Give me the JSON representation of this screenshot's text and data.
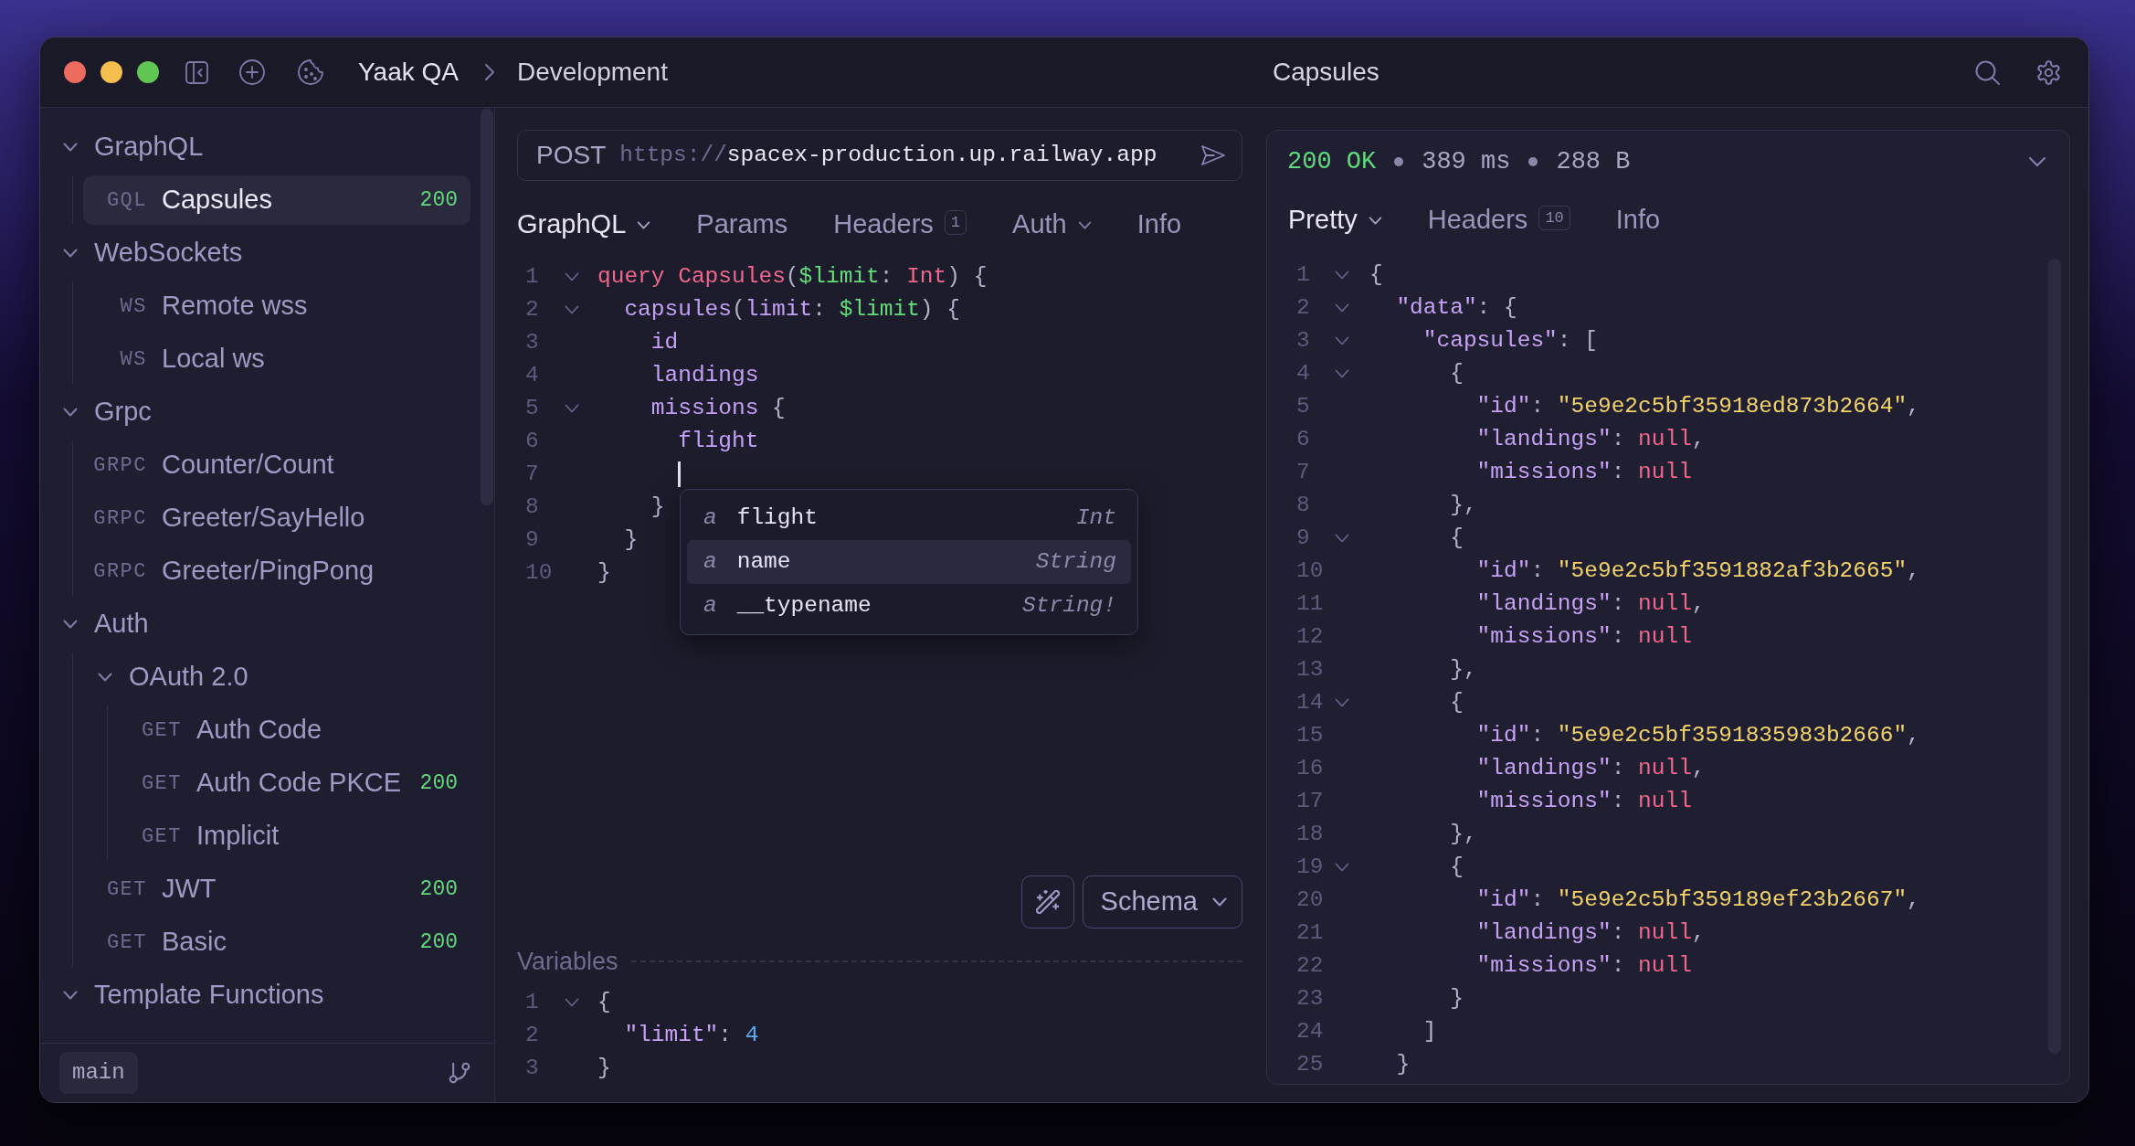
{
  "title_bar": {
    "workspace": "Yaak QA",
    "environment": "Development",
    "request_title": "Capsules"
  },
  "sidebar": {
    "items": [
      {
        "kind": "folder",
        "label": "GraphQL",
        "expanded": true,
        "selected": false,
        "children": [
          {
            "kind": "request",
            "method": "GQL",
            "label": "Capsules",
            "status": "200",
            "selected": true
          }
        ]
      },
      {
        "kind": "folder",
        "label": "WebSockets",
        "expanded": true,
        "selected": false,
        "children": [
          {
            "kind": "request",
            "method": "WS",
            "label": "Remote wss",
            "selected": false
          },
          {
            "kind": "request",
            "method": "WS",
            "label": "Local ws",
            "selected": false
          }
        ]
      },
      {
        "kind": "folder",
        "label": "Grpc",
        "expanded": true,
        "selected": false,
        "children": [
          {
            "kind": "request",
            "method": "GRPC",
            "label": "Counter/Count",
            "selected": false
          },
          {
            "kind": "request",
            "method": "GRPC",
            "label": "Greeter/SayHello",
            "selected": false
          },
          {
            "kind": "request",
            "method": "GRPC",
            "label": "Greeter/PingPong",
            "selected": false
          }
        ]
      },
      {
        "kind": "folder",
        "label": "Auth",
        "expanded": true,
        "selected": false,
        "children": [
          {
            "kind": "folder",
            "label": "OAuth 2.0",
            "expanded": true,
            "selected": false,
            "children": [
              {
                "kind": "request",
                "method": "GET",
                "label": "Auth Code",
                "selected": false
              },
              {
                "kind": "request",
                "method": "GET",
                "label": "Auth Code PKCE",
                "status": "200",
                "selected": false
              },
              {
                "kind": "request",
                "method": "GET",
                "label": "Implicit",
                "selected": false
              }
            ]
          },
          {
            "kind": "request",
            "method": "GET",
            "label": "JWT",
            "status": "200",
            "selected": false
          },
          {
            "kind": "request",
            "method": "GET",
            "label": "Basic",
            "status": "200",
            "selected": false
          }
        ]
      },
      {
        "kind": "folder",
        "label": "Template Functions",
        "expanded": true,
        "selected": false
      }
    ],
    "branch": "main"
  },
  "request": {
    "method": "POST",
    "url_scheme": "https://",
    "url_host": "spacex-production.up.railway.app",
    "tabs": [
      {
        "label": "GraphQL",
        "dropdown": true,
        "selected": true
      },
      {
        "label": "Params",
        "selected": false
      },
      {
        "label": "Headers",
        "badge": "1",
        "selected": false
      },
      {
        "label": "Auth",
        "dropdown": true,
        "selected": false
      },
      {
        "label": "Info",
        "selected": false
      }
    ],
    "query_lines": [
      {
        "number": "1",
        "tokens": [
          {
            "kind": "keyword",
            "text": "query "
          },
          {
            "kind": "name",
            "text": "Capsules"
          },
          {
            "kind": "punct",
            "text": "("
          },
          {
            "kind": "variable",
            "text": "$limit"
          },
          {
            "kind": "punct",
            "text": ": "
          },
          {
            "kind": "type",
            "text": "Int"
          },
          {
            "kind": "punct",
            "text": ") {"
          }
        ],
        "children": [
          {
            "number": "2",
            "tokens": [
              {
                "kind": "field",
                "text": "capsules"
              },
              {
                "kind": "punct",
                "text": "("
              },
              {
                "kind": "field",
                "text": "limit"
              },
              {
                "kind": "punct",
                "text": ": "
              },
              {
                "kind": "variable",
                "text": "$limit"
              },
              {
                "kind": "punct",
                "text": ") {"
              }
            ],
            "children": [
              {
                "number": "3",
                "tokens": [
                  {
                    "kind": "field",
                    "text": "id"
                  }
                ]
              },
              {
                "number": "4",
                "tokens": [
                  {
                    "kind": "field",
                    "text": "landings"
                  }
                ]
              },
              {
                "number": "5",
                "tokens": [
                  {
                    "kind": "field",
                    "text": "missions"
                  },
                  {
                    "kind": "punct",
                    "text": " {"
                  }
                ],
                "children": [
                  {
                    "number": "6",
                    "tokens": [
                      {
                        "kind": "field",
                        "text": "flight"
                      }
                    ]
                  },
                  {
                    "number": "7",
                    "cursor": true
                  }
                ]
              },
              {
                "number": "8",
                "tokens": [
                  {
                    "kind": "punct",
                    "text": "}"
                  }
                ]
              }
            ]
          },
          {
            "number": "9",
            "tokens": [
              {
                "kind": "punct",
                "text": "}"
              }
            ]
          }
        ]
      },
      {
        "number": "10",
        "tokens": [
          {
            "kind": "punct",
            "text": "}"
          }
        ]
      }
    ],
    "autocomplete": [
      {
        "kind_glyph": "a",
        "label": "flight",
        "type": "Int",
        "selected": false
      },
      {
        "kind_glyph": "a",
        "label": "name",
        "type": "String",
        "selected": true
      },
      {
        "kind_glyph": "a",
        "label": "__typename",
        "type": "String!",
        "selected": false
      }
    ],
    "schema_button": "Schema",
    "variables_label": "Variables",
    "variables_lines": [
      {
        "number": "1",
        "tokens": [
          {
            "kind": "punct",
            "text": "{"
          }
        ],
        "children": [
          {
            "number": "2",
            "tokens": [
              {
                "kind": "key",
                "text": "\"limit\""
              },
              {
                "kind": "punct",
                "text": ": "
              },
              {
                "kind": "number",
                "text": "4"
              }
            ]
          }
        ]
      },
      {
        "number": "3",
        "tokens": [
          {
            "kind": "punct",
            "text": "}"
          }
        ]
      }
    ]
  },
  "response": {
    "status": "200 OK",
    "time": "389 ms",
    "size": "288 B",
    "tabs": [
      {
        "label": "Pretty",
        "dropdown": true,
        "selected": true
      },
      {
        "label": "Headers",
        "badge": "10",
        "selected": false
      },
      {
        "label": "Info",
        "selected": false
      }
    ],
    "lines": [
      {
        "number": "1",
        "tokens": [
          {
            "kind": "punct",
            "text": "{"
          }
        ],
        "children": [
          {
            "number": "2",
            "tokens": [
              {
                "kind": "key",
                "text": "\"data\""
              },
              {
                "kind": "punct",
                "text": ": {"
              }
            ],
            "children": [
              {
                "number": "3",
                "tokens": [
                  {
                    "kind": "key",
                    "text": "\"capsules\""
                  },
                  {
                    "kind": "punct",
                    "text": ": ["
                  }
                ],
                "children": [
                  {
                    "number": "4",
                    "tokens": [
                      {
                        "kind": "punct",
                        "text": "{"
                      }
                    ],
                    "children": [
                      {
                        "number": "5",
                        "tokens": [
                          {
                            "kind": "key",
                            "text": "\"id\""
                          },
                          {
                            "kind": "punct",
                            "text": ": "
                          },
                          {
                            "kind": "string",
                            "text": "\"5e9e2c5bf35918ed873b2664\""
                          },
                          {
                            "kind": "punct",
                            "text": ","
                          }
                        ]
                      },
                      {
                        "number": "6",
                        "tokens": [
                          {
                            "kind": "key",
                            "text": "\"landings\""
                          },
                          {
                            "kind": "punct",
                            "text": ": "
                          },
                          {
                            "kind": "null",
                            "text": "null"
                          },
                          {
                            "kind": "punct",
                            "text": ","
                          }
                        ]
                      },
                      {
                        "number": "7",
                        "tokens": [
                          {
                            "kind": "key",
                            "text": "\"missions\""
                          },
                          {
                            "kind": "punct",
                            "text": ": "
                          },
                          {
                            "kind": "null",
                            "text": "null"
                          }
                        ]
                      }
                    ]
                  },
                  {
                    "number": "8",
                    "tokens": [
                      {
                        "kind": "punct",
                        "text": "},"
                      }
                    ]
                  },
                  {
                    "number": "9",
                    "tokens": [
                      {
                        "kind": "punct",
                        "text": "{"
                      }
                    ],
                    "children": [
                      {
                        "number": "10",
                        "tokens": [
                          {
                            "kind": "key",
                            "text": "\"id\""
                          },
                          {
                            "kind": "punct",
                            "text": ": "
                          },
                          {
                            "kind": "string",
                            "text": "\"5e9e2c5bf3591882af3b2665\""
                          },
                          {
                            "kind": "punct",
                            "text": ","
                          }
                        ]
                      },
                      {
                        "number": "11",
                        "tokens": [
                          {
                            "kind": "key",
                            "text": "\"landings\""
                          },
                          {
                            "kind": "punct",
                            "text": ": "
                          },
                          {
                            "kind": "null",
                            "text": "null"
                          },
                          {
                            "kind": "punct",
                            "text": ","
                          }
                        ]
                      },
                      {
                        "number": "12",
                        "tokens": [
                          {
                            "kind": "key",
                            "text": "\"missions\""
                          },
                          {
                            "kind": "punct",
                            "text": ": "
                          },
                          {
                            "kind": "null",
                            "text": "null"
                          }
                        ]
                      }
                    ]
                  },
                  {
                    "number": "13",
                    "tokens": [
                      {
                        "kind": "punct",
                        "text": "},"
                      }
                    ]
                  },
                  {
                    "number": "14",
                    "tokens": [
                      {
                        "kind": "punct",
                        "text": "{"
                      }
                    ],
                    "children": [
                      {
                        "number": "15",
                        "tokens": [
                          {
                            "kind": "key",
                            "text": "\"id\""
                          },
                          {
                            "kind": "punct",
                            "text": ": "
                          },
                          {
                            "kind": "string",
                            "text": "\"5e9e2c5bf3591835983b2666\""
                          },
                          {
                            "kind": "punct",
                            "text": ","
                          }
                        ]
                      },
                      {
                        "number": "16",
                        "tokens": [
                          {
                            "kind": "key",
                            "text": "\"landings\""
                          },
                          {
                            "kind": "punct",
                            "text": ": "
                          },
                          {
                            "kind": "null",
                            "text": "null"
                          },
                          {
                            "kind": "punct",
                            "text": ","
                          }
                        ]
                      },
                      {
                        "number": "17",
                        "tokens": [
                          {
                            "kind": "key",
                            "text": "\"missions\""
                          },
                          {
                            "kind": "punct",
                            "text": ": "
                          },
                          {
                            "kind": "null",
                            "text": "null"
                          }
                        ]
                      }
                    ]
                  },
                  {
                    "number": "18",
                    "tokens": [
                      {
                        "kind": "punct",
                        "text": "},"
                      }
                    ]
                  },
                  {
                    "number": "19",
                    "tokens": [
                      {
                        "kind": "punct",
                        "text": "{"
                      }
                    ],
                    "children": [
                      {
                        "number": "20",
                        "tokens": [
                          {
                            "kind": "key",
                            "text": "\"id\""
                          },
                          {
                            "kind": "punct",
                            "text": ": "
                          },
                          {
                            "kind": "string",
                            "text": "\"5e9e2c5bf359189ef23b2667\""
                          },
                          {
                            "kind": "punct",
                            "text": ","
                          }
                        ]
                      },
                      {
                        "number": "21",
                        "tokens": [
                          {
                            "kind": "key",
                            "text": "\"landings\""
                          },
                          {
                            "kind": "punct",
                            "text": ": "
                          },
                          {
                            "kind": "null",
                            "text": "null"
                          },
                          {
                            "kind": "punct",
                            "text": ","
                          }
                        ]
                      },
                      {
                        "number": "22",
                        "tokens": [
                          {
                            "kind": "key",
                            "text": "\"missions\""
                          },
                          {
                            "kind": "punct",
                            "text": ": "
                          },
                          {
                            "kind": "null",
                            "text": "null"
                          }
                        ]
                      }
                    ]
                  },
                  {
                    "number": "23",
                    "tokens": [
                      {
                        "kind": "punct",
                        "text": "}"
                      }
                    ]
                  }
                ]
              },
              {
                "number": "24",
                "tokens": [
                  {
                    "kind": "punct",
                    "text": "]"
                  }
                ]
              }
            ]
          },
          {
            "number": "25",
            "tokens": [
              {
                "kind": "punct",
                "text": "}"
              }
            ]
          }
        ]
      }
    ]
  }
}
